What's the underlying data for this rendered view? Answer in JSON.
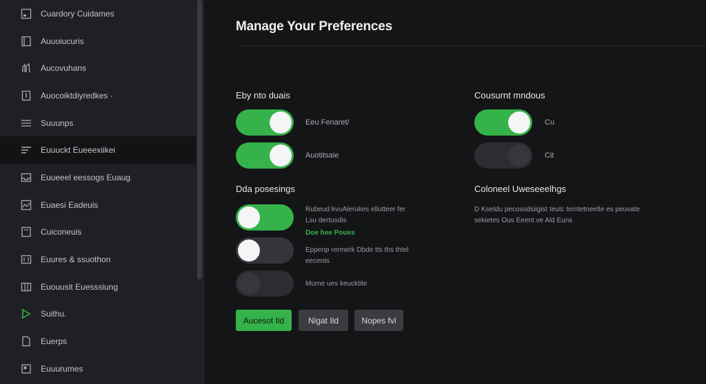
{
  "sidebar": {
    "items": [
      {
        "label": "Cuardory Cuidames",
        "icon": "square-icon"
      },
      {
        "label": "Auuoiucuris",
        "icon": "book-icon"
      },
      {
        "label": "Aucovuhans",
        "icon": "people-icon"
      },
      {
        "label": "Auocoiktdiyredkes ·",
        "icon": "document-icon"
      },
      {
        "label": "Suuunps",
        "icon": "list-icon"
      },
      {
        "label": "Euuuckt Eueeexiikei",
        "icon": "menu-icon"
      },
      {
        "label": "Euueeel eessogs Euaug",
        "icon": "inbox-icon"
      },
      {
        "label": "Euaesi Eadeuis",
        "icon": "chart-icon"
      },
      {
        "label": "Cuiconeuis",
        "icon": "note-icon"
      },
      {
        "label": "Euures & ssuothon",
        "icon": "calendar-icon"
      },
      {
        "label": "Euouusit Euesssiung",
        "icon": "grid-icon"
      },
      {
        "label": "Suithu.",
        "icon": "play-icon"
      },
      {
        "label": "Euerps",
        "icon": "file-icon"
      },
      {
        "label": "Euuurumes",
        "icon": "box-icon"
      }
    ],
    "active_index": 4
  },
  "page": {
    "title": "Manage Your Preferences"
  },
  "sections": {
    "left_top": {
      "heading": "Eby nto duais",
      "toggles": [
        {
          "label": "Eeu Fenaret/",
          "state": "on"
        },
        {
          "label": "Auotitsaie",
          "state": "on"
        }
      ]
    },
    "right_top": {
      "heading": "Cousurnt mndous",
      "toggles": [
        {
          "label": "Cu",
          "state": "on"
        },
        {
          "label": "Cit",
          "state": "disabled"
        }
      ]
    },
    "left_bottom": {
      "heading": "Dda posesings",
      "toggles": [
        {
          "desc_line1": "Rubeud kvuAlerukes ellutteer fer",
          "desc_line2": "Lsu dertusdis",
          "link": "Doe hee Poues",
          "state": "on-left"
        },
        {
          "desc_line1": "Eppenp rermerk Dbde tts ths thtel",
          "desc_line2": "eecents",
          "state": "off"
        },
        {
          "desc_line1": "Murne ues keucktite",
          "state": "disabled"
        }
      ]
    },
    "right_bottom": {
      "heading": "Coloneel Uweseeelhgs",
      "desc_line1": "D Ksetdu pecossdsiigist teutc temtetneelte es peuvate",
      "desc_line2": "sekietes Ous Eeent ve Ald Euns"
    }
  },
  "buttons": {
    "accept": "Aucesot Ild",
    "reject": "Nigat Ild",
    "manage": "Nopes fvl"
  },
  "colors": {
    "accent": "#36b24a",
    "background": "#141517",
    "sidebar": "#1e2024"
  }
}
